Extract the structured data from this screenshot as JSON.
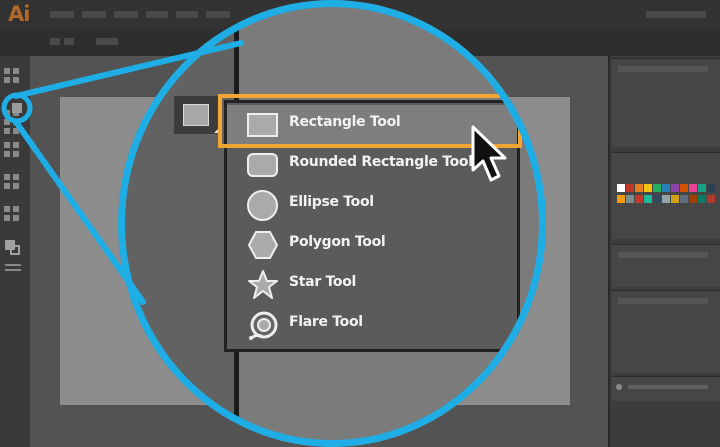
{
  "app": {
    "logo_text": "Ai",
    "brand_color": "#b1692a"
  },
  "colors": {
    "zoom_ring": "#1eaee5",
    "selection_highlight": "#f3a534"
  },
  "flyout_menu": {
    "selected_index": 0,
    "items": [
      {
        "label": "Rectangle Tool",
        "icon": "rectangle-icon"
      },
      {
        "label": "Rounded Rectangle Tool",
        "icon": "rounded-rectangle-icon"
      },
      {
        "label": "Ellipse Tool",
        "icon": "ellipse-icon"
      },
      {
        "label": "Polygon Tool",
        "icon": "polygon-icon"
      },
      {
        "label": "Star Tool",
        "icon": "star-icon"
      },
      {
        "label": "Flare Tool",
        "icon": "flare-icon"
      }
    ]
  },
  "swatches": [
    "#ffffff",
    "#c0392b",
    "#e67e22",
    "#f1c40f",
    "#27ae60",
    "#2980b9",
    "#8e44ad",
    "#d35400",
    "#e84393",
    "#16a085",
    "#2c3e50",
    "#f39c12",
    "#7f8c8d",
    "#c0392b",
    "#1abc9c",
    "#34495e",
    "#95a5a6",
    "#d4a017",
    "#5d6d7e",
    "#a04000",
    "#117a65",
    "#b03a2e"
  ]
}
